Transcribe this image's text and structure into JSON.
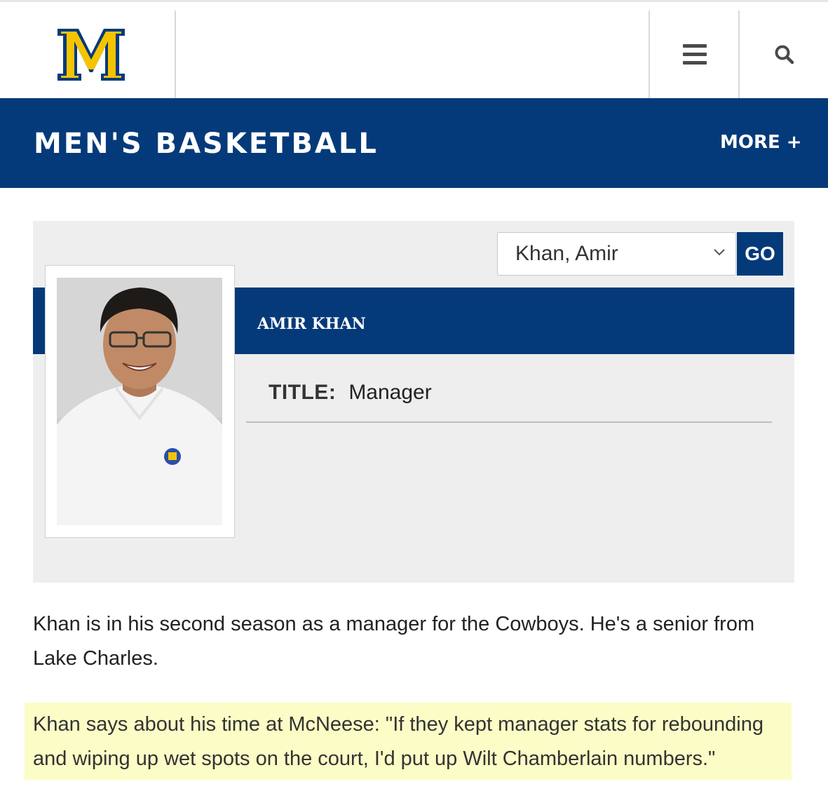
{
  "header": {
    "logo_letter": "M",
    "menu_icon": "hamburger-menu-icon",
    "search_icon": "search-icon"
  },
  "banner": {
    "title": "MEN'S BASKETBALL",
    "more_label": "MORE +"
  },
  "roster_select": {
    "selected": "Khan, Amir",
    "go_label": "GO"
  },
  "profile": {
    "name": "AMIR KHAN",
    "title_label": "TITLE:",
    "title_value": "Manager"
  },
  "bio": {
    "text": "Khan is in his second season as a manager for the Cowboys. He's a senior from Lake Charles.",
    "quote": "Khan says about his time at McNeese: \"If they kept manager stats for rebounding and wiping up wet spots on the court, I'd put up Wilt Chamberlain numbers.\""
  },
  "colors": {
    "brand_blue": "#053a7a",
    "brand_gold": "#f5c400",
    "panel_gray": "#eeeeee",
    "highlight_yellow": "#fcfcc6"
  }
}
